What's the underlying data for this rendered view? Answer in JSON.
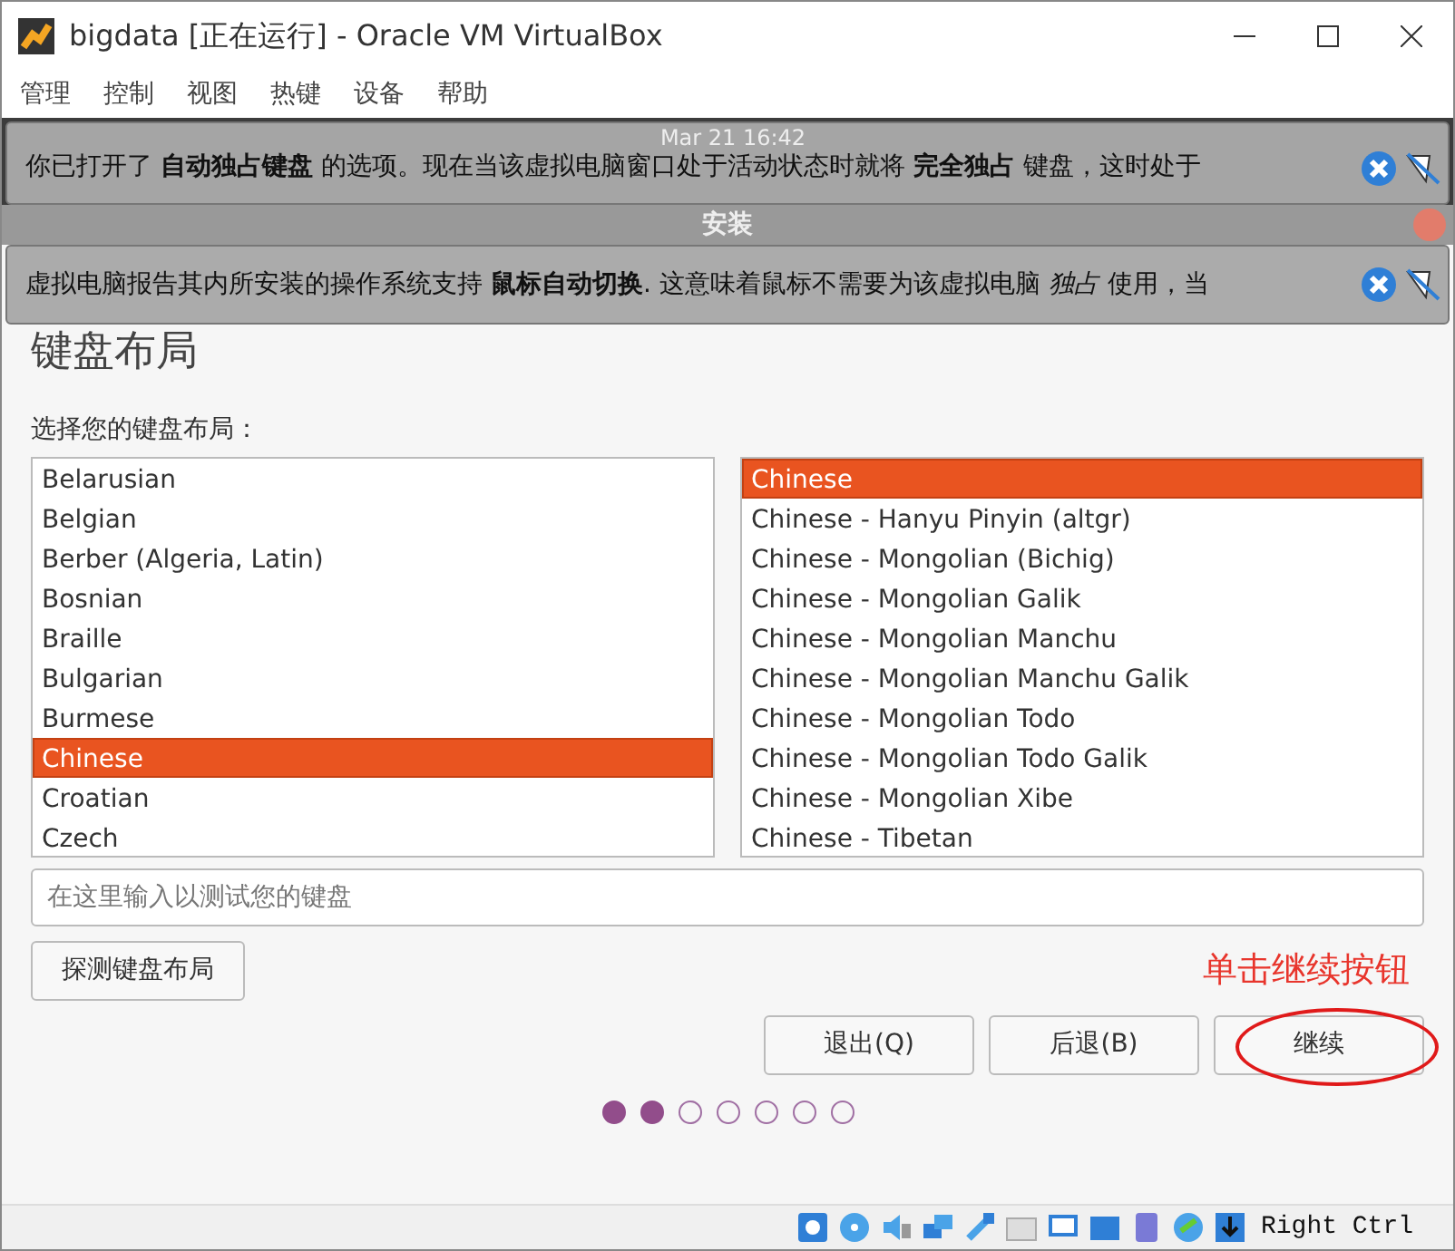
{
  "window": {
    "title": "bigdata [正在运行] - Oracle VM VirtualBox"
  },
  "menu": [
    "管理",
    "控制",
    "视图",
    "热键",
    "设备",
    "帮助"
  ],
  "vm_top_bar": {
    "clock": "Mar 21  16:42"
  },
  "notifications": [
    {
      "text": "你已打开了 **自动独占键盘** 的选项。现在当该虚拟电脑窗口处于活动状态时就将 **完全独占** 键盘，这时处于"
    },
    {
      "text": "虚拟电脑报告其内所安装的操作系统支持 **鼠标自动切换**. 这意味着鼠标不需要为该虚拟电脑 *独占* 使用，当"
    }
  ],
  "installer": {
    "title": "安装",
    "heading": "键盘布局",
    "prompt": "选择您的键盘布局：",
    "layouts": [
      {
        "label": "Belarusian",
        "selected": false
      },
      {
        "label": "Belgian",
        "selected": false
      },
      {
        "label": "Berber (Algeria, Latin)",
        "selected": false
      },
      {
        "label": "Bosnian",
        "selected": false
      },
      {
        "label": "Braille",
        "selected": false
      },
      {
        "label": "Bulgarian",
        "selected": false
      },
      {
        "label": "Burmese",
        "selected": false
      },
      {
        "label": "Chinese",
        "selected": true
      },
      {
        "label": "Croatian",
        "selected": false
      },
      {
        "label": "Czech",
        "selected": false
      }
    ],
    "variants": [
      {
        "label": "Chinese",
        "selected": true
      },
      {
        "label": "Chinese - Hanyu Pinyin (altgr)",
        "selected": false
      },
      {
        "label": "Chinese - Mongolian (Bichig)",
        "selected": false
      },
      {
        "label": "Chinese - Mongolian Galik",
        "selected": false
      },
      {
        "label": "Chinese - Mongolian Manchu",
        "selected": false
      },
      {
        "label": "Chinese - Mongolian Manchu Galik",
        "selected": false
      },
      {
        "label": "Chinese - Mongolian Todo",
        "selected": false
      },
      {
        "label": "Chinese - Mongolian Todo Galik",
        "selected": false
      },
      {
        "label": "Chinese - Mongolian Xibe",
        "selected": false
      },
      {
        "label": "Chinese - Tibetan",
        "selected": false
      }
    ],
    "test_field": {
      "placeholder": "在这里输入以测试您的键盘"
    },
    "detect_button": "探测键盘布局",
    "annotation": "单击继续按钮",
    "buttons": [
      {
        "label": "退出(Q)",
        "circled": false
      },
      {
        "label": "后退(B)",
        "circled": false
      },
      {
        "label": "继续",
        "circled": true
      }
    ],
    "steps": [
      {
        "done": true
      },
      {
        "done": true
      },
      {
        "done": false
      },
      {
        "done": false
      },
      {
        "done": false
      },
      {
        "done": false
      },
      {
        "done": false
      }
    ]
  },
  "status_bar": {
    "host_key": "Right Ctrl"
  }
}
